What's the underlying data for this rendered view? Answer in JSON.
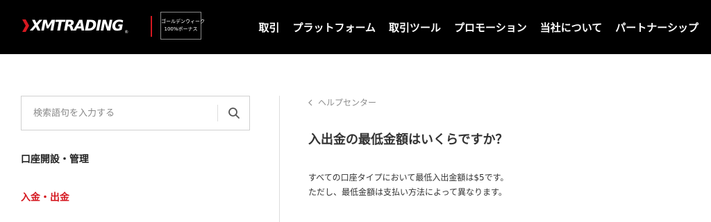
{
  "header": {
    "logo": {
      "text": "XMTRADING",
      "reg": "®"
    },
    "promo": {
      "line1": "ゴールデンウィーク",
      "line2": "100%ボーナス"
    },
    "nav": [
      {
        "label": "取引"
      },
      {
        "label": "プラットフォーム"
      },
      {
        "label": "取引ツール"
      },
      {
        "label": "プロモーション"
      },
      {
        "label": "当社について"
      },
      {
        "label": "パートナーシップ"
      }
    ]
  },
  "sidebar": {
    "search": {
      "placeholder": "検索語句を入力する",
      "icon": "search-icon"
    },
    "items": [
      {
        "label": "口座開設・管理"
      },
      {
        "label": "入金・出金",
        "active": true,
        "active_color": "#d51820"
      }
    ]
  },
  "main": {
    "breadcrumb": {
      "label": "ヘルプセンター",
      "icon": "chevron-left-icon"
    },
    "title": "入出金の最低金額はいくらですか？",
    "paragraphs": [
      "すべての口座タイプにおいて最低入出金額は$5です。",
      "ただし、最低金額は支払い方法によって異なります。"
    ]
  },
  "colors": {
    "header_bg": "#000000",
    "accent": "#d51820",
    "text": "#333333",
    "muted": "#8c8c8c"
  }
}
